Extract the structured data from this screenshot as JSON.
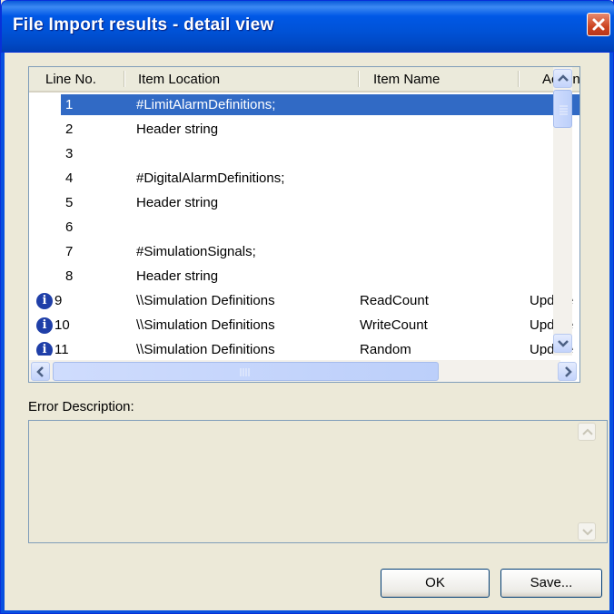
{
  "window": {
    "title": "File Import results - detail view",
    "close_icon": "close-icon"
  },
  "table": {
    "columns": [
      "Line No.",
      "Item Location",
      "Item Name",
      "Action"
    ],
    "rows": [
      {
        "line": "1",
        "location": "#LimitAlarmDefinitions;",
        "name": "",
        "action": "",
        "info": false,
        "selected": true
      },
      {
        "line": "2",
        "location": "Header string",
        "name": "",
        "action": "",
        "info": false
      },
      {
        "line": "3",
        "location": "",
        "name": "",
        "action": "",
        "info": false
      },
      {
        "line": "4",
        "location": "#DigitalAlarmDefinitions;",
        "name": "",
        "action": "",
        "info": false
      },
      {
        "line": "5",
        "location": "Header string",
        "name": "",
        "action": "",
        "info": false
      },
      {
        "line": "6",
        "location": "",
        "name": "",
        "action": "",
        "info": false
      },
      {
        "line": "7",
        "location": "#SimulationSignals;",
        "name": "",
        "action": "",
        "info": false
      },
      {
        "line": "8",
        "location": "Header string",
        "name": "",
        "action": "",
        "info": false
      },
      {
        "line": "9",
        "location": "\\\\Simulation Definitions",
        "name": "ReadCount",
        "action": "Update",
        "info": true
      },
      {
        "line": "10",
        "location": "\\\\Simulation Definitions",
        "name": "WriteCount",
        "action": "Update",
        "info": true
      },
      {
        "line": "11",
        "location": "\\\\Simulation Definitions",
        "name": "Random",
        "action": "Update",
        "info": true
      }
    ]
  },
  "error": {
    "label": "Error Description:",
    "text": ""
  },
  "buttons": {
    "ok": "OK",
    "save": "Save..."
  },
  "colors": {
    "titlebar": "#0054e3",
    "selection": "#316ac5",
    "dialog_bg": "#ece9d8"
  }
}
